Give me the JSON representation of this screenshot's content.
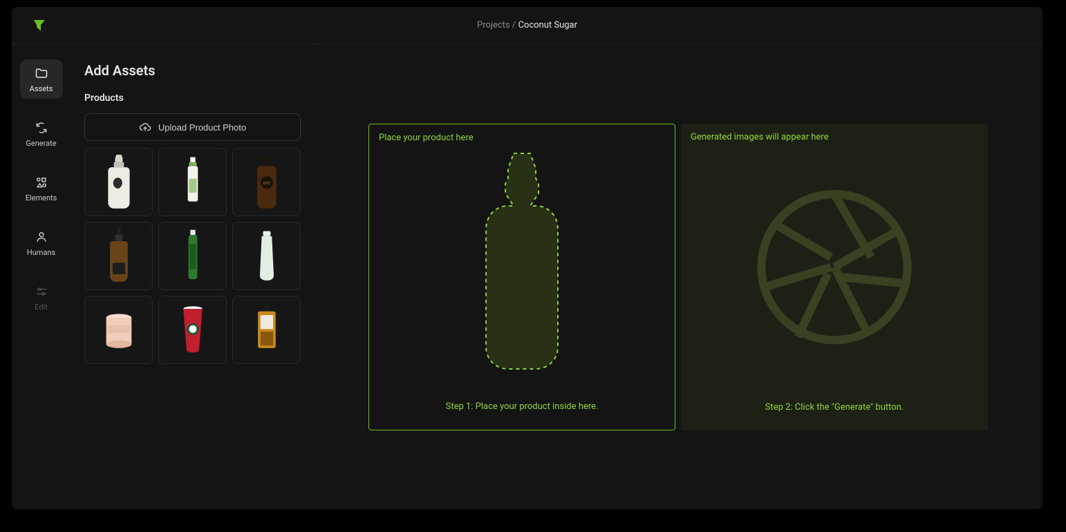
{
  "breadcrumb": {
    "root": "Projects",
    "separator": " / ",
    "current": "Coconut Sugar"
  },
  "nav": {
    "items": [
      {
        "label": "Assets",
        "icon": "folder-icon",
        "active": true
      },
      {
        "label": "Generate",
        "icon": "refresh-icon",
        "active": false
      },
      {
        "label": "Elements",
        "icon": "shapes-icon",
        "active": false
      },
      {
        "label": "Humans",
        "icon": "person-icon",
        "active": false
      },
      {
        "label": "Edit",
        "icon": "sliders-icon",
        "active": false,
        "disabled": true
      }
    ]
  },
  "sidebar": {
    "title": "Add Assets",
    "section_label": "Products",
    "upload_label": "Upload Product Photo",
    "products": [
      {
        "name": "white-dropper-bottle"
      },
      {
        "name": "small-spray-bottle"
      },
      {
        "name": "whisky-bottle-dyc"
      },
      {
        "name": "amber-serum-dropper"
      },
      {
        "name": "green-tall-bottle"
      },
      {
        "name": "white-tube"
      },
      {
        "name": "pink-candle-jar"
      },
      {
        "name": "red-starbucks-cup"
      },
      {
        "name": "amber-perfume-bottle"
      }
    ]
  },
  "canvas": {
    "product_zone": {
      "label": "Place your product here",
      "step": "Step 1: Place your product inside here."
    },
    "generated_zone": {
      "label": "Generated images will appear here",
      "step": "Step 2: Click the \"Generate\" button."
    }
  },
  "colors": {
    "accent": "#6fbf1f",
    "accent_text": "#8fd43f"
  }
}
